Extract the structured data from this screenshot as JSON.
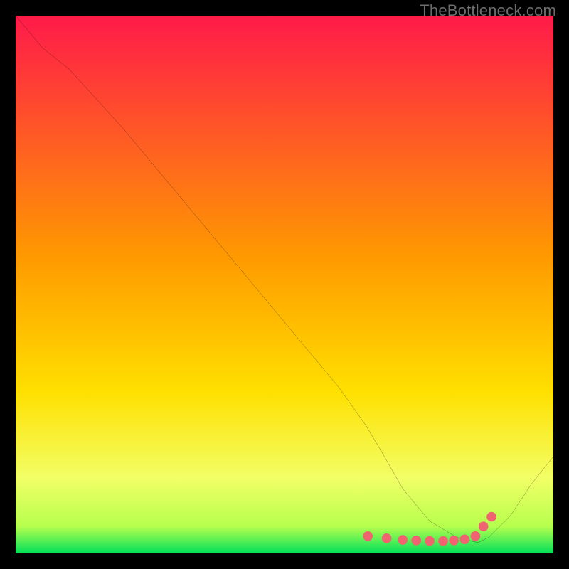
{
  "watermark": "TheBottleneck.com",
  "colors": {
    "frame": "#000000",
    "gradient_top": "#ff1a4a",
    "gradient_mid": "#ffd400",
    "gradient_low": "#f2ff66",
    "gradient_bottom": "#00e05a",
    "curve": "#000000",
    "marker": "#ef6470"
  },
  "chart_data": {
    "type": "line",
    "title": "",
    "xlabel": "",
    "ylabel": "",
    "xlim": [
      0,
      100
    ],
    "ylim": [
      0,
      100
    ],
    "curve": {
      "x": [
        0,
        5,
        10,
        20,
        30,
        40,
        50,
        60,
        65,
        68,
        72,
        77,
        82,
        86,
        88,
        92,
        96,
        100
      ],
      "y": [
        100,
        94,
        90,
        79,
        67,
        55,
        43,
        31,
        24,
        19,
        12,
        6,
        3,
        2,
        3,
        7,
        13,
        18
      ]
    },
    "markers": {
      "x": [
        65.5,
        69,
        72,
        74.5,
        77,
        79.5,
        81.5,
        83.5,
        85.5,
        87,
        88.5
      ],
      "y": [
        3.2,
        2.8,
        2.5,
        2.4,
        2.3,
        2.3,
        2.4,
        2.6,
        3.2,
        5.0,
        6.8
      ]
    }
  }
}
